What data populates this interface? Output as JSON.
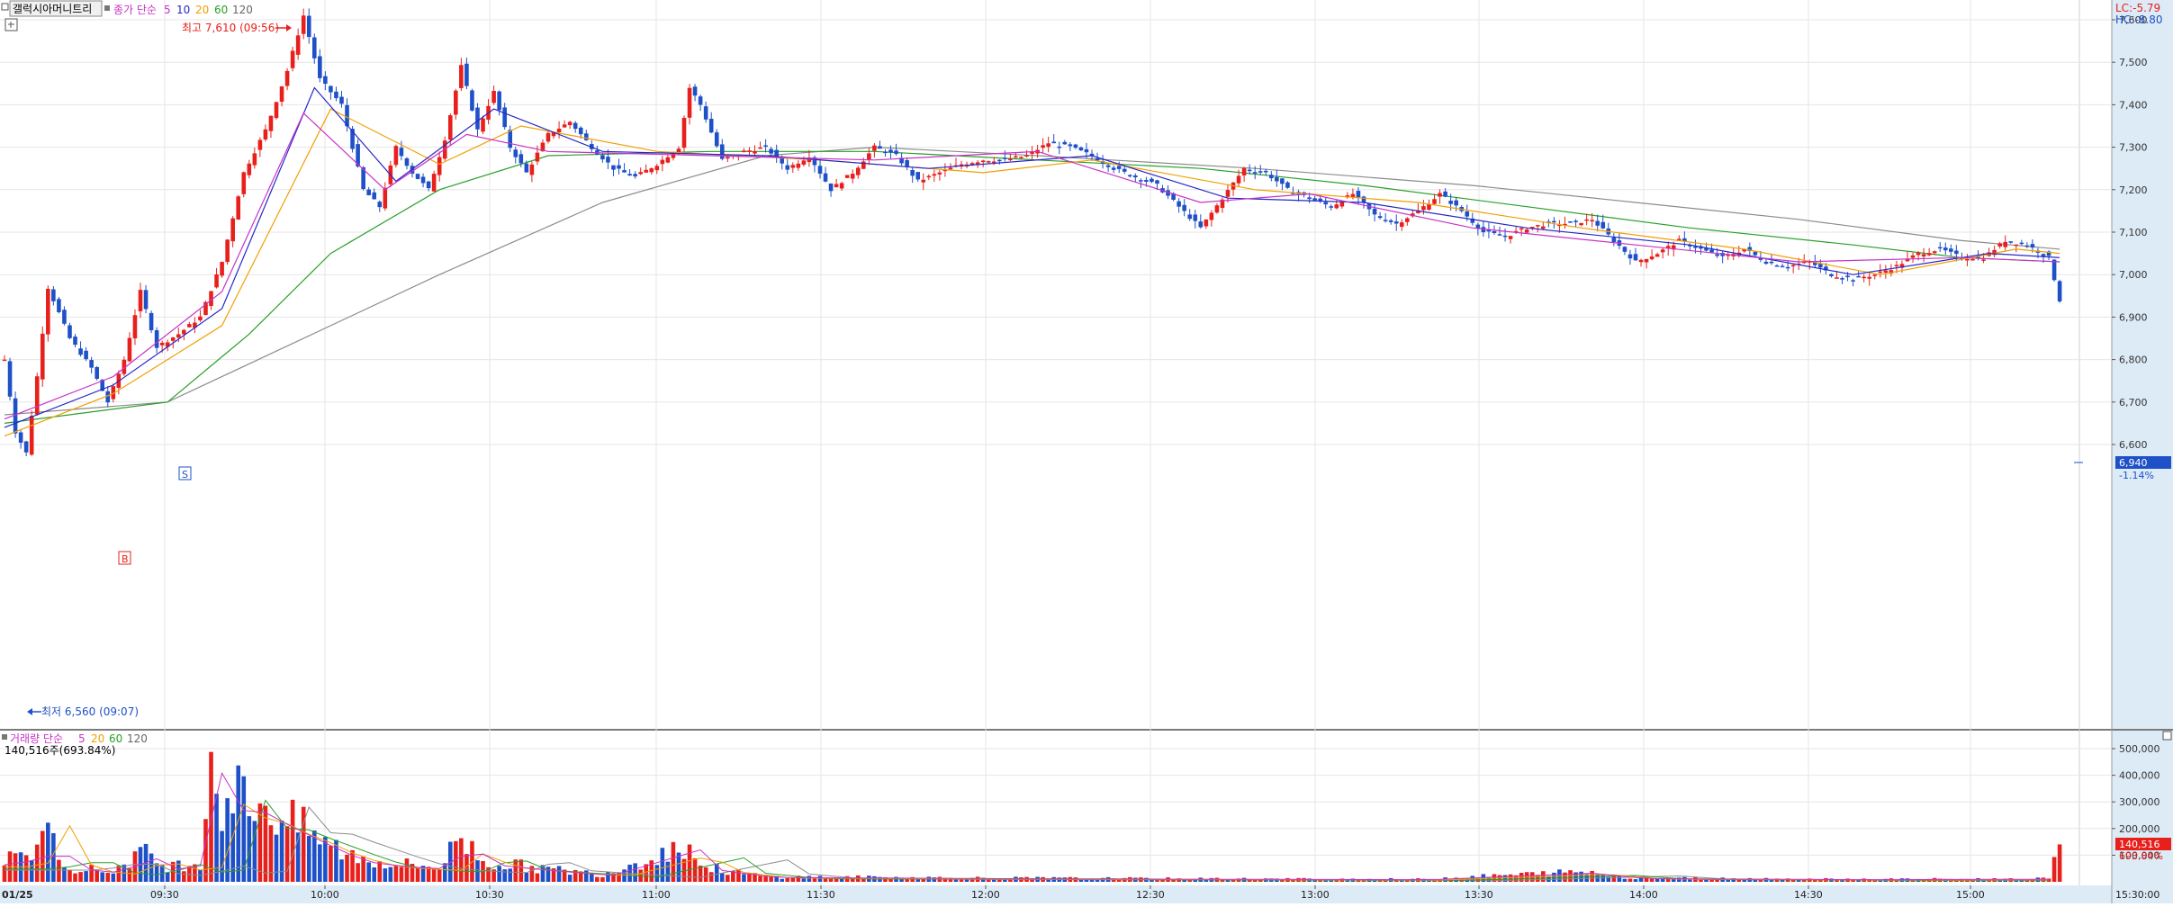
{
  "header": {
    "stock_name": "갤럭시아머니트리",
    "price_legend_prefix": "종가 단순",
    "ma_periods": [
      "5",
      "10",
      "20",
      "60",
      "120"
    ],
    "volume_legend_prefix": "거래량 단순",
    "volume_summary": "140,516주(693.84%)",
    "lc_label": "LC:-5.79",
    "hc_label": "HC:-8.80"
  },
  "annotations": {
    "high_label": "최고 7,610 (09:56)",
    "low_label": "최저 6,560 (09:07)",
    "marker_b": "B",
    "marker_s": "S"
  },
  "colors": {
    "up": "#e8201c",
    "down": "#1e50c8",
    "ma5": "#c832c8",
    "ma10": "#2828c8",
    "ma20": "#f0a000",
    "ma60": "#28a028",
    "ma120": "#8c8c8c",
    "grid": "#e6e6e6",
    "axis_bg": "#ddebf7",
    "current_price_box": "#1e50c8",
    "current_volume_box": "#e8201c"
  },
  "chart_data": [
    {
      "name": "price",
      "type": "candlestick",
      "x_tick_labels": [
        "01/25",
        "09:30",
        "10:00",
        "10:30",
        "11:00",
        "11:30",
        "12:00",
        "12:30",
        "13:00",
        "13:30",
        "14:00",
        "14:30",
        "15:00",
        "15:30:00"
      ],
      "y_ticks": [
        6600,
        6700,
        6800,
        6900,
        7000,
        7100,
        7200,
        7300,
        7400,
        7500,
        7600
      ],
      "y_tick_labels": [
        "6,600",
        "6,700",
        "6,800",
        "6,900",
        "7,000",
        "7,100",
        "7,200",
        "7,300",
        "7,400",
        "7,500",
        "7,600"
      ],
      "ylim": [
        6530,
        7640
      ],
      "current_price": 6940,
      "current_price_label": "6,940",
      "current_change_label": "-1.14%",
      "high": 7610,
      "low": 6560,
      "price_path": [
        [
          0,
          6800
        ],
        [
          2,
          6630
        ],
        [
          4,
          6580
        ],
        [
          6,
          6760
        ],
        [
          8,
          6970
        ],
        [
          12,
          6850
        ],
        [
          16,
          6780
        ],
        [
          19,
          6700
        ],
        [
          22,
          6800
        ],
        [
          25,
          6960
        ],
        [
          28,
          6830
        ],
        [
          32,
          6860
        ],
        [
          36,
          6900
        ],
        [
          40,
          7030
        ],
        [
          44,
          7240
        ],
        [
          48,
          7340
        ],
        [
          52,
          7480
        ],
        [
          55,
          7610
        ],
        [
          58,
          7460
        ],
        [
          62,
          7400
        ],
        [
          66,
          7200
        ],
        [
          69,
          7160
        ],
        [
          72,
          7300
        ],
        [
          75,
          7240
        ],
        [
          78,
          7200
        ],
        [
          81,
          7320
        ],
        [
          84,
          7490
        ],
        [
          87,
          7340
        ],
        [
          90,
          7430
        ],
        [
          93,
          7300
        ],
        [
          96,
          7240
        ],
        [
          100,
          7330
        ],
        [
          104,
          7360
        ],
        [
          108,
          7300
        ],
        [
          112,
          7250
        ],
        [
          116,
          7230
        ],
        [
          120,
          7260
        ],
        [
          124,
          7300
        ],
        [
          126,
          7440
        ],
        [
          128,
          7400
        ],
        [
          132,
          7270
        ],
        [
          136,
          7290
        ],
        [
          140,
          7300
        ],
        [
          144,
          7250
        ],
        [
          148,
          7280
        ],
        [
          152,
          7200
        ],
        [
          156,
          7240
        ],
        [
          160,
          7300
        ],
        [
          164,
          7280
        ],
        [
          168,
          7220
        ],
        [
          172,
          7240
        ],
        [
          176,
          7260
        ],
        [
          180,
          7270
        ],
        [
          184,
          7270
        ],
        [
          188,
          7280
        ],
        [
          192,
          7310
        ],
        [
          196,
          7300
        ],
        [
          200,
          7280
        ],
        [
          204,
          7250
        ],
        [
          208,
          7230
        ],
        [
          212,
          7210
        ],
        [
          216,
          7160
        ],
        [
          220,
          7110
        ],
        [
          224,
          7180
        ],
        [
          228,
          7250
        ],
        [
          232,
          7240
        ],
        [
          236,
          7200
        ],
        [
          240,
          7180
        ],
        [
          244,
          7160
        ],
        [
          248,
          7190
        ],
        [
          252,
          7140
        ],
        [
          256,
          7120
        ],
        [
          260,
          7150
        ],
        [
          264,
          7190
        ],
        [
          268,
          7150
        ],
        [
          272,
          7100
        ],
        [
          276,
          7090
        ],
        [
          280,
          7110
        ],
        [
          284,
          7120
        ],
        [
          288,
          7120
        ],
        [
          292,
          7130
        ],
        [
          296,
          7080
        ],
        [
          300,
          7030
        ],
        [
          304,
          7050
        ],
        [
          308,
          7080
        ],
        [
          312,
          7060
        ],
        [
          316,
          7040
        ],
        [
          320,
          7060
        ],
        [
          324,
          7030
        ],
        [
          328,
          7020
        ],
        [
          332,
          7030
        ],
        [
          336,
          7000
        ],
        [
          340,
          6990
        ],
        [
          344,
          7000
        ],
        [
          348,
          7020
        ],
        [
          352,
          7050
        ],
        [
          356,
          7060
        ],
        [
          360,
          7040
        ],
        [
          364,
          7040
        ],
        [
          368,
          7080
        ],
        [
          372,
          7070
        ],
        [
          376,
          7040
        ],
        [
          378,
          6940
        ]
      ],
      "ma_paths": {
        "ma5": [
          [
            0,
            6660
          ],
          [
            20,
            6760
          ],
          [
            40,
            6960
          ],
          [
            55,
            7380
          ],
          [
            70,
            7200
          ],
          [
            85,
            7330
          ],
          [
            100,
            7290
          ],
          [
            130,
            7280
          ],
          [
            160,
            7270
          ],
          [
            190,
            7290
          ],
          [
            220,
            7170
          ],
          [
            240,
            7190
          ],
          [
            270,
            7110
          ],
          [
            300,
            7070
          ],
          [
            330,
            7030
          ],
          [
            360,
            7040
          ],
          [
            378,
            7030
          ]
        ],
        "ma10": [
          [
            0,
            6640
          ],
          [
            20,
            6740
          ],
          [
            40,
            6920
          ],
          [
            57,
            7440
          ],
          [
            72,
            7220
          ],
          [
            90,
            7390
          ],
          [
            110,
            7290
          ],
          [
            140,
            7280
          ],
          [
            170,
            7250
          ],
          [
            200,
            7280
          ],
          [
            225,
            7180
          ],
          [
            250,
            7170
          ],
          [
            280,
            7110
          ],
          [
            310,
            7070
          ],
          [
            340,
            7000
          ],
          [
            365,
            7050
          ],
          [
            378,
            7040
          ]
        ],
        "ma20": [
          [
            0,
            6620
          ],
          [
            20,
            6720
          ],
          [
            40,
            6880
          ],
          [
            60,
            7390
          ],
          [
            80,
            7260
          ],
          [
            95,
            7350
          ],
          [
            120,
            7290
          ],
          [
            150,
            7270
          ],
          [
            180,
            7240
          ],
          [
            200,
            7270
          ],
          [
            230,
            7200
          ],
          [
            260,
            7170
          ],
          [
            290,
            7110
          ],
          [
            320,
            7060
          ],
          [
            345,
            7000
          ],
          [
            370,
            7060
          ],
          [
            378,
            7050
          ]
        ],
        "ma60": [
          [
            0,
            6650
          ],
          [
            30,
            6700
          ],
          [
            45,
            6860
          ],
          [
            60,
            7050
          ],
          [
            80,
            7200
          ],
          [
            100,
            7280
          ],
          [
            130,
            7290
          ],
          [
            160,
            7290
          ],
          [
            190,
            7270
          ],
          [
            220,
            7250
          ],
          [
            250,
            7210
          ],
          [
            280,
            7160
          ],
          [
            310,
            7110
          ],
          [
            340,
            7070
          ],
          [
            360,
            7040
          ],
          [
            378,
            7030
          ]
        ],
        "ma120": [
          [
            0,
            6670
          ],
          [
            30,
            6700
          ],
          [
            50,
            6820
          ],
          [
            80,
            7000
          ],
          [
            110,
            7170
          ],
          [
            140,
            7280
          ],
          [
            160,
            7300
          ],
          [
            190,
            7280
          ],
          [
            230,
            7250
          ],
          [
            270,
            7210
          ],
          [
            300,
            7170
          ],
          [
            330,
            7130
          ],
          [
            360,
            7080
          ],
          [
            378,
            7060
          ]
        ]
      }
    },
    {
      "name": "volume",
      "type": "bar",
      "y_ticks": [
        100000,
        200000,
        300000,
        400000,
        500000
      ],
      "y_tick_labels": [
        "100,000",
        "200,000",
        "300,000",
        "400,000",
        "500,000"
      ],
      "ylim": [
        0,
        560000
      ],
      "current_volume": 140516,
      "current_volume_label": "140,516",
      "current_ratio_label": "693.84%",
      "volume_profile": [
        [
          0,
          80000
        ],
        [
          6,
          120000
        ],
        [
          7,
          300000
        ],
        [
          8,
          180000
        ],
        [
          12,
          60000
        ],
        [
          20,
          40000
        ],
        [
          25,
          120000
        ],
        [
          30,
          60000
        ],
        [
          36,
          80000
        ],
        [
          38,
          510000
        ],
        [
          40,
          320000
        ],
        [
          44,
          350000
        ],
        [
          48,
          300000
        ],
        [
          52,
          240000
        ],
        [
          56,
          200000
        ],
        [
          60,
          140000
        ],
        [
          66,
          90000
        ],
        [
          72,
          70000
        ],
        [
          80,
          60000
        ],
        [
          84,
          180000
        ],
        [
          88,
          80000
        ],
        [
          100,
          50000
        ],
        [
          110,
          30000
        ],
        [
          126,
          150000
        ],
        [
          128,
          60000
        ],
        [
          140,
          20000
        ],
        [
          180,
          15000
        ],
        [
          220,
          12000
        ],
        [
          260,
          10000
        ],
        [
          290,
          40000
        ],
        [
          300,
          15000
        ],
        [
          340,
          10000
        ],
        [
          376,
          12000
        ],
        [
          378,
          140516
        ]
      ]
    }
  ]
}
